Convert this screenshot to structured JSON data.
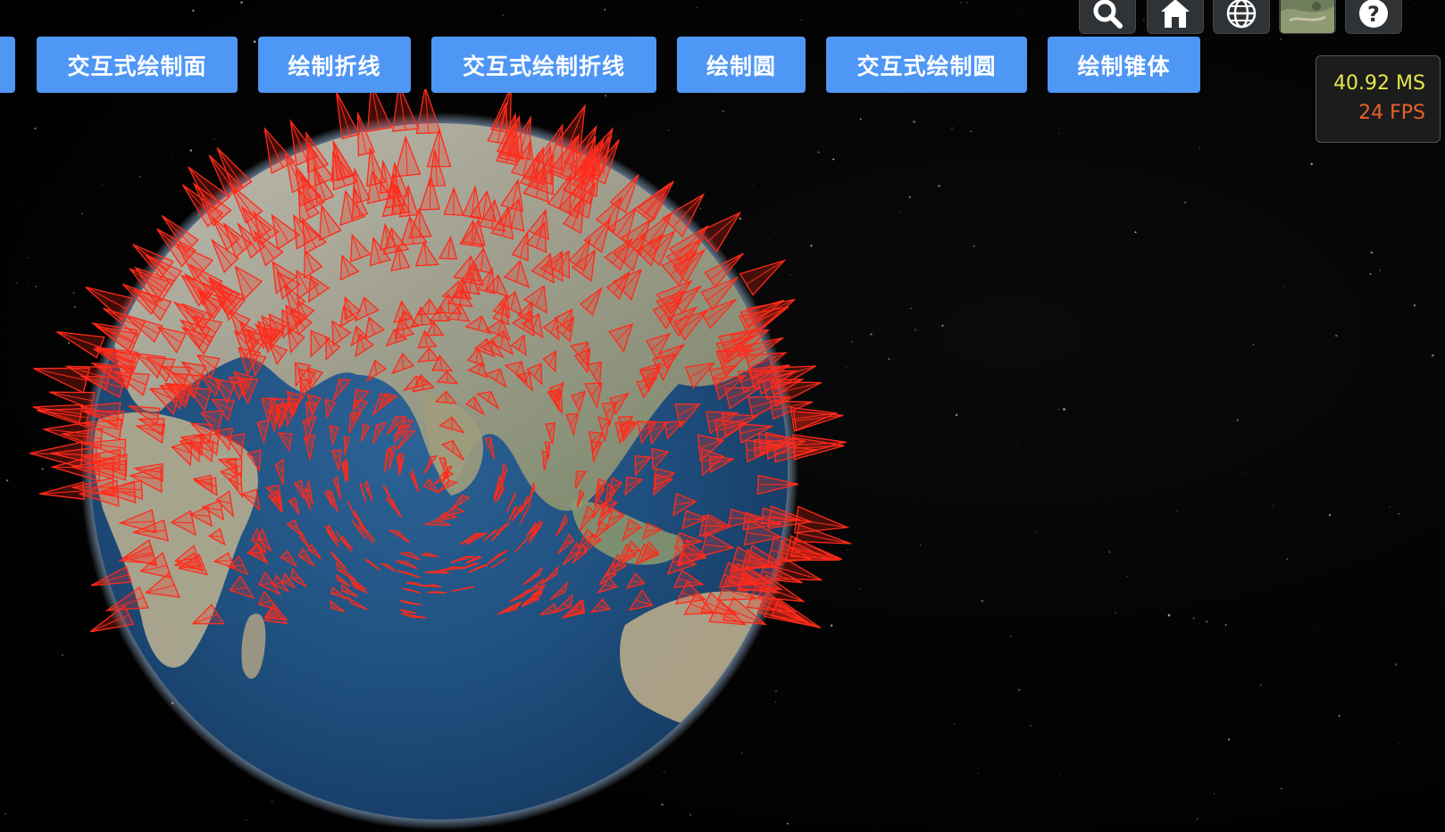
{
  "toolbar": {
    "buttons": [
      {
        "label": "交互式绘制面"
      },
      {
        "label": "绘制折线"
      },
      {
        "label": "交互式绘制折线"
      },
      {
        "label": "绘制圆"
      },
      {
        "label": "交互式绘制圆"
      },
      {
        "label": "绘制锥体"
      }
    ]
  },
  "cesium_toolbar": {
    "icons": [
      "search-icon",
      "home-icon",
      "globe-icon",
      "imagery-thumbnail",
      "help-icon"
    ]
  },
  "performance": {
    "ms_value": "40.92",
    "ms_unit": "MS",
    "fps_value": "24",
    "fps_unit": "FPS"
  },
  "colors": {
    "button_bg": "#4f97f5",
    "cone_color": "#ff2a1a",
    "ms_color": "#e7e74a",
    "fps_color": "#e6622b",
    "ocean": "#1f4f7e"
  }
}
